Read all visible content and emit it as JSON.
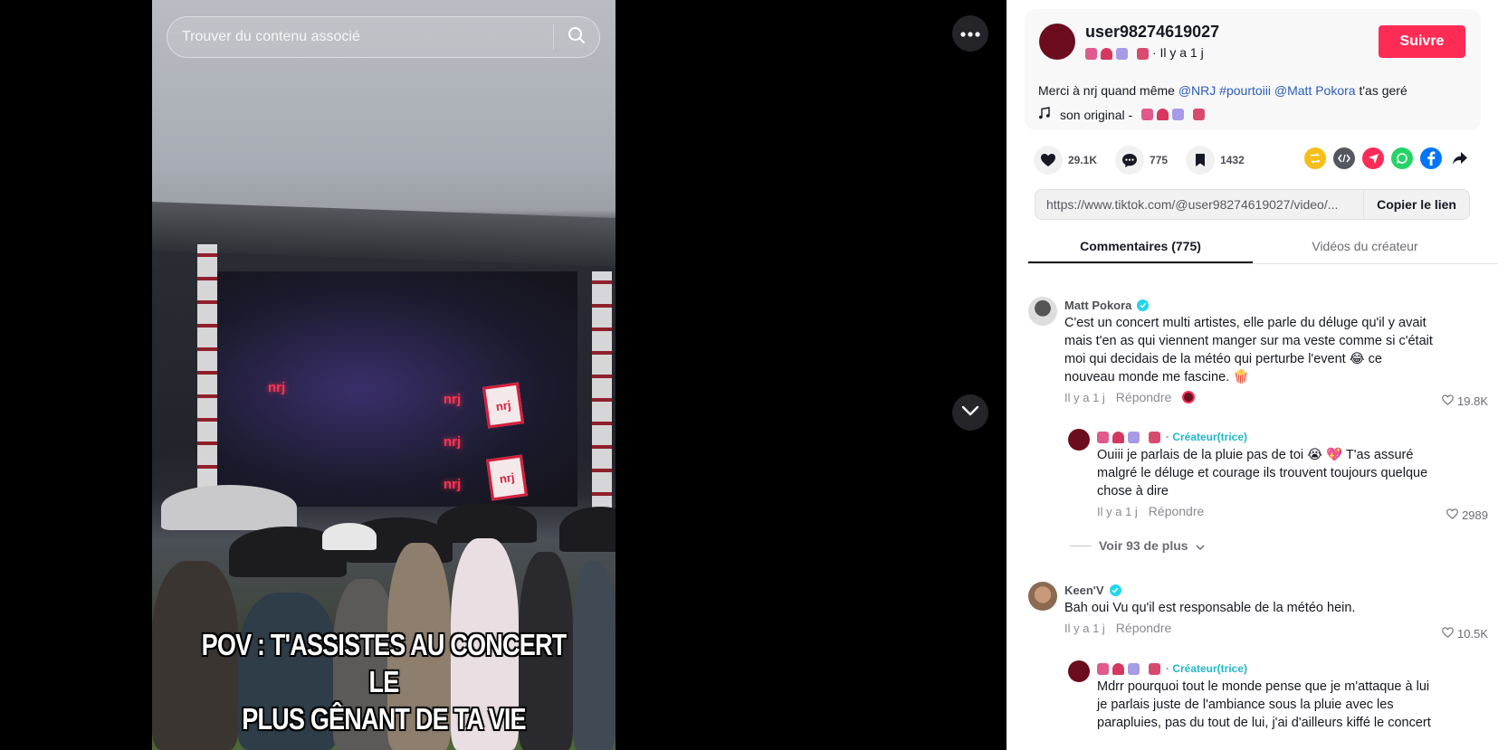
{
  "search": {
    "placeholder": "Trouver du contenu associé"
  },
  "video": {
    "caption_line1": "POV : T'ASSISTES AU CONCERT LE",
    "caption_line2": "PLUS GÊNANT DE TA VIE",
    "sign_text": "nrj"
  },
  "author": {
    "username": "user98274619027",
    "time": "· Il y a 1 j",
    "follow_label": "Suivre",
    "description_prefix": "Merci à nrj quand même ",
    "description_tag1": "@NRJ",
    "description_tag2": "#pourtoiii",
    "description_tag3": "@Matt Pokora",
    "description_suffix": " t'as geré",
    "music": "son original -",
    "avatar_color": "#6b0d1e"
  },
  "stats": {
    "likes": "29.1K",
    "comments": "775",
    "saves": "1432"
  },
  "link": {
    "url": "https://www.tiktok.com/@user98274619027/video/...",
    "copy_label": "Copier le lien"
  },
  "tabs": {
    "comments": "Commentaires (775)",
    "creator_videos": "Vidéos du créateur"
  },
  "comments": [
    {
      "name": "Matt Pokora",
      "text": "C'est un concert multi artistes, elle parle du déluge qu'il y avait mais t'en as qui viennent manger sur ma veste comme si c'était moi qui decidais de la météo qui perturbe l'event 😂 ce nouveau monde me fascine. 🍿",
      "time": "Il y a 1 j",
      "reply": "Répondre",
      "likes": "19.8K"
    },
    {
      "creator_label": "· Créateur(trice)",
      "text": "Ouiii je parlais de la pluie pas de toi 😭 💖 T'as assuré malgré le déluge et courage ils trouvent toujours quelque chose à dire",
      "time": "Il y a 1 j",
      "reply": "Répondre",
      "likes": "2989"
    },
    {
      "name": "Keen'V",
      "text": "Bah oui Vu qu'il est responsable de la météo hein.",
      "time": "Il y a 1 j",
      "reply": "Répondre",
      "likes": "10.5K"
    },
    {
      "creator_label": "· Créateur(trice)",
      "text": "Mdrr pourquoi tout le monde pense que je m'attaque à lui je parlais juste de l'ambiance sous la pluie avec les parapluies, pas du tout de lui, j'ai d'ailleurs kiffé le concert"
    }
  ],
  "see_more": "Voir 93 de plus",
  "colors": {
    "accent": "#fe2c55",
    "link": "#2b5db9",
    "creator": "#20b8c8"
  }
}
